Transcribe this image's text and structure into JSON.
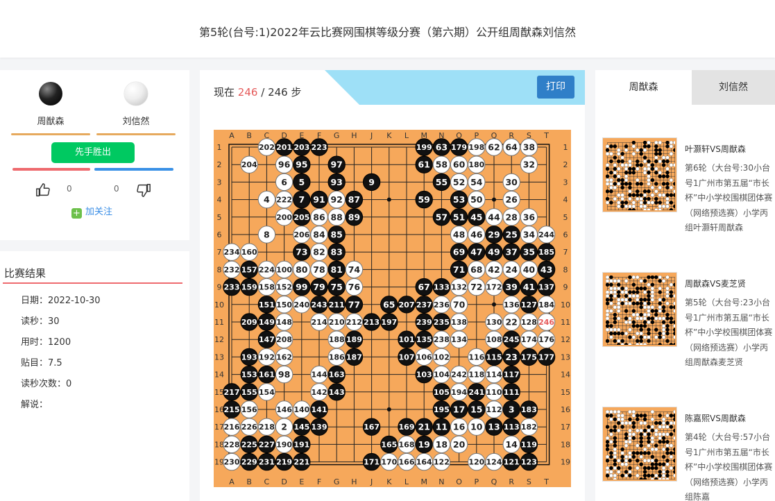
{
  "header": {
    "title": "第5轮(台号:1)2022年云比赛网围棋等级分赛（第六期）公开组周猷森刘信然"
  },
  "players": {
    "black_name": "周猷森",
    "white_name": "刘信然",
    "result_button": "先手胜出",
    "like_count": "0",
    "dislike_count": "0",
    "follow_label": "加关注"
  },
  "result": {
    "title": "比赛结果",
    "items": [
      "日期：2022-10-30",
      "读秒：30",
      "用时：1200",
      "贴目：7.5",
      "读秒次数：0",
      "解说："
    ]
  },
  "board": {
    "move_prefix": "现在",
    "current_move": "246",
    "separator": "/",
    "total_moves": "246",
    "move_suffix": "步",
    "print_label": "打印",
    "columns": [
      "A",
      "B",
      "C",
      "D",
      "E",
      "F",
      "G",
      "H",
      "J",
      "K",
      "L",
      "M",
      "N",
      "O",
      "P",
      "Q",
      "R",
      "S",
      "T"
    ],
    "rows": [
      "1",
      "2",
      "3",
      "4",
      "5",
      "6",
      "7",
      "8",
      "9",
      "10",
      "11",
      "12",
      "13",
      "14",
      "15",
      "16",
      "17",
      "18",
      "19"
    ],
    "last_move_color": "#e55a5a",
    "stones": [
      [
        "C1",
        "w",
        "202"
      ],
      [
        "D1",
        "b",
        "201"
      ],
      [
        "E1",
        "b",
        "203"
      ],
      [
        "F1",
        "b",
        "223"
      ],
      [
        "M1",
        "b",
        "199"
      ],
      [
        "N1",
        "b",
        "63"
      ],
      [
        "O1",
        "b",
        "179"
      ],
      [
        "P1",
        "w",
        "198"
      ],
      [
        "Q1",
        "w",
        "62"
      ],
      [
        "R1",
        "w",
        "64"
      ],
      [
        "S1",
        "w",
        "38"
      ],
      [
        "B2",
        "w",
        "204"
      ],
      [
        "D2",
        "w",
        "96"
      ],
      [
        "E2",
        "b",
        "95"
      ],
      [
        "G2",
        "b",
        "97"
      ],
      [
        "M2",
        "b",
        "61"
      ],
      [
        "N2",
        "w",
        "58"
      ],
      [
        "O2",
        "w",
        "60"
      ],
      [
        "P2",
        "w",
        "180"
      ],
      [
        "S2",
        "w",
        "32"
      ],
      [
        "D3",
        "w",
        "6"
      ],
      [
        "E3",
        "b",
        "5"
      ],
      [
        "G3",
        "b",
        "93"
      ],
      [
        "J3",
        "b",
        "9"
      ],
      [
        "N3",
        "b",
        "55"
      ],
      [
        "O3",
        "w",
        "52"
      ],
      [
        "P3",
        "w",
        "54"
      ],
      [
        "R3",
        "w",
        "30"
      ],
      [
        "C4",
        "w",
        "4"
      ],
      [
        "D4",
        "w",
        "222"
      ],
      [
        "E4",
        "b",
        "7"
      ],
      [
        "F4",
        "b",
        "91"
      ],
      [
        "G4",
        "w",
        "92"
      ],
      [
        "H4",
        "b",
        "87"
      ],
      [
        "M4",
        "b",
        "59"
      ],
      [
        "O4",
        "b",
        "53"
      ],
      [
        "P4",
        "w",
        "50"
      ],
      [
        "R4",
        "w",
        "26"
      ],
      [
        "D5",
        "w",
        "200"
      ],
      [
        "E5",
        "b",
        "205"
      ],
      [
        "F5",
        "w",
        "86"
      ],
      [
        "G5",
        "w",
        "88"
      ],
      [
        "H5",
        "b",
        "89"
      ],
      [
        "N5",
        "b",
        "57"
      ],
      [
        "O5",
        "b",
        "51"
      ],
      [
        "P5",
        "b",
        "45"
      ],
      [
        "Q5",
        "w",
        "44"
      ],
      [
        "R5",
        "w",
        "28"
      ],
      [
        "S5",
        "w",
        "36"
      ],
      [
        "C6",
        "w",
        "8"
      ],
      [
        "E6",
        "w",
        "206"
      ],
      [
        "F6",
        "w",
        "84"
      ],
      [
        "G6",
        "b",
        "85"
      ],
      [
        "O6",
        "w",
        "48"
      ],
      [
        "P6",
        "w",
        "46"
      ],
      [
        "Q6",
        "b",
        "29"
      ],
      [
        "R6",
        "b",
        "25"
      ],
      [
        "S6",
        "w",
        "34"
      ],
      [
        "T6",
        "w",
        "244"
      ],
      [
        "A7",
        "w",
        "234"
      ],
      [
        "B7",
        "w",
        "160"
      ],
      [
        "E7",
        "b",
        "73"
      ],
      [
        "F7",
        "w",
        "82"
      ],
      [
        "G7",
        "b",
        "83"
      ],
      [
        "O7",
        "b",
        "69"
      ],
      [
        "P7",
        "b",
        "47"
      ],
      [
        "Q7",
        "b",
        "49"
      ],
      [
        "R7",
        "b",
        "37"
      ],
      [
        "S7",
        "b",
        "35"
      ],
      [
        "T7",
        "b",
        "185"
      ],
      [
        "A8",
        "w",
        "232"
      ],
      [
        "B8",
        "b",
        "157"
      ],
      [
        "C8",
        "w",
        "224"
      ],
      [
        "D8",
        "w",
        "100"
      ],
      [
        "E8",
        "w",
        "80"
      ],
      [
        "F8",
        "w",
        "78"
      ],
      [
        "G8",
        "b",
        "81"
      ],
      [
        "H8",
        "w",
        "74"
      ],
      [
        "O8",
        "b",
        "71"
      ],
      [
        "P8",
        "w",
        "68"
      ],
      [
        "Q8",
        "w",
        "42"
      ],
      [
        "R8",
        "w",
        "24"
      ],
      [
        "S8",
        "w",
        "40"
      ],
      [
        "T8",
        "b",
        "43"
      ],
      [
        "A9",
        "b",
        "233"
      ],
      [
        "B9",
        "b",
        "159"
      ],
      [
        "C9",
        "w",
        "158"
      ],
      [
        "D9",
        "w",
        "152"
      ],
      [
        "E9",
        "b",
        "99"
      ],
      [
        "F9",
        "b",
        "79"
      ],
      [
        "G9",
        "b",
        "75"
      ],
      [
        "H9",
        "w",
        "76"
      ],
      [
        "M9",
        "b",
        "67"
      ],
      [
        "N9",
        "b",
        "133"
      ],
      [
        "O9",
        "w",
        "132"
      ],
      [
        "P9",
        "w",
        "72"
      ],
      [
        "Q9",
        "w",
        "172"
      ],
      [
        "R9",
        "b",
        "39"
      ],
      [
        "S9",
        "b",
        "41"
      ],
      [
        "T9",
        "b",
        "137"
      ],
      [
        "C10",
        "b",
        "151"
      ],
      [
        "D10",
        "w",
        "150"
      ],
      [
        "E10",
        "w",
        "240"
      ],
      [
        "F10",
        "b",
        "243"
      ],
      [
        "G10",
        "b",
        "211"
      ],
      [
        "H10",
        "b",
        "77"
      ],
      [
        "K10",
        "b",
        "65"
      ],
      [
        "L10",
        "b",
        "207"
      ],
      [
        "M10",
        "b",
        "237"
      ],
      [
        "N10",
        "w",
        "236"
      ],
      [
        "O10",
        "w",
        "70"
      ],
      [
        "R10",
        "w",
        "136"
      ],
      [
        "S10",
        "b",
        "127"
      ],
      [
        "T10",
        "w",
        "184"
      ],
      [
        "B11",
        "b",
        "209"
      ],
      [
        "C11",
        "b",
        "149"
      ],
      [
        "D11",
        "w",
        "148"
      ],
      [
        "F11",
        "w",
        "214"
      ],
      [
        "G11",
        "w",
        "210"
      ],
      [
        "H11",
        "w",
        "212"
      ],
      [
        "J11",
        "b",
        "213"
      ],
      [
        "K11",
        "b",
        "197"
      ],
      [
        "M11",
        "b",
        "239"
      ],
      [
        "N11",
        "b",
        "235"
      ],
      [
        "O11",
        "w",
        "138"
      ],
      [
        "Q11",
        "w",
        "130"
      ],
      [
        "R11",
        "w",
        "22"
      ],
      [
        "S11",
        "w",
        "128"
      ],
      [
        "T11",
        "w",
        "246"
      ],
      [
        "C12",
        "b",
        "147"
      ],
      [
        "D12",
        "w",
        "208"
      ],
      [
        "G12",
        "w",
        "188"
      ],
      [
        "H12",
        "b",
        "189"
      ],
      [
        "L12",
        "b",
        "101"
      ],
      [
        "M12",
        "b",
        "135"
      ],
      [
        "N12",
        "w",
        "238"
      ],
      [
        "O12",
        "w",
        "134"
      ],
      [
        "Q12",
        "w",
        "108"
      ],
      [
        "R12",
        "b",
        "245"
      ],
      [
        "S12",
        "w",
        "174"
      ],
      [
        "T12",
        "w",
        "176"
      ],
      [
        "B13",
        "b",
        "193"
      ],
      [
        "C13",
        "w",
        "192"
      ],
      [
        "D13",
        "w",
        "162"
      ],
      [
        "G13",
        "w",
        "186"
      ],
      [
        "H13",
        "b",
        "187"
      ],
      [
        "L13",
        "b",
        "107"
      ],
      [
        "M13",
        "w",
        "106"
      ],
      [
        "N13",
        "w",
        "102"
      ],
      [
        "P13",
        "w",
        "116"
      ],
      [
        "Q13",
        "b",
        "115"
      ],
      [
        "R13",
        "b",
        "23"
      ],
      [
        "S13",
        "b",
        "175"
      ],
      [
        "T13",
        "b",
        "177"
      ],
      [
        "B14",
        "b",
        "153"
      ],
      [
        "C14",
        "b",
        "161"
      ],
      [
        "D14",
        "w",
        "98"
      ],
      [
        "F14",
        "w",
        "144"
      ],
      [
        "G14",
        "b",
        "163"
      ],
      [
        "M14",
        "b",
        "103"
      ],
      [
        "N14",
        "w",
        "104"
      ],
      [
        "O14",
        "w",
        "242"
      ],
      [
        "P14",
        "w",
        "118"
      ],
      [
        "Q14",
        "w",
        "114"
      ],
      [
        "R14",
        "b",
        "117"
      ],
      [
        "A15",
        "b",
        "217"
      ],
      [
        "B15",
        "b",
        "155"
      ],
      [
        "C15",
        "w",
        "154"
      ],
      [
        "F15",
        "w",
        "142"
      ],
      [
        "G15",
        "b",
        "143"
      ],
      [
        "N15",
        "b",
        "105"
      ],
      [
        "O15",
        "w",
        "194"
      ],
      [
        "P15",
        "b",
        "241"
      ],
      [
        "Q15",
        "w",
        "110"
      ],
      [
        "R15",
        "b",
        "111"
      ],
      [
        "A16",
        "b",
        "215"
      ],
      [
        "B16",
        "w",
        "156"
      ],
      [
        "D16",
        "w",
        "146"
      ],
      [
        "E16",
        "w",
        "140"
      ],
      [
        "F16",
        "b",
        "141"
      ],
      [
        "N16",
        "b",
        "195"
      ],
      [
        "O16",
        "b",
        "17"
      ],
      [
        "P16",
        "b",
        "15"
      ],
      [
        "Q16",
        "w",
        "112"
      ],
      [
        "R16",
        "b",
        "3"
      ],
      [
        "S16",
        "b",
        "183"
      ],
      [
        "A17",
        "w",
        "216"
      ],
      [
        "B17",
        "w",
        "226"
      ],
      [
        "C17",
        "w",
        "218"
      ],
      [
        "D17",
        "w",
        "2"
      ],
      [
        "E17",
        "b",
        "145"
      ],
      [
        "F17",
        "b",
        "139"
      ],
      [
        "J17",
        "b",
        "167"
      ],
      [
        "L17",
        "b",
        "169"
      ],
      [
        "M17",
        "b",
        "21"
      ],
      [
        "N17",
        "b",
        "11"
      ],
      [
        "O17",
        "w",
        "16"
      ],
      [
        "P17",
        "w",
        "10"
      ],
      [
        "Q17",
        "b",
        "13"
      ],
      [
        "R17",
        "b",
        "113"
      ],
      [
        "S17",
        "w",
        "182"
      ],
      [
        "A18",
        "w",
        "228"
      ],
      [
        "B18",
        "b",
        "225"
      ],
      [
        "C18",
        "b",
        "227"
      ],
      [
        "D18",
        "w",
        "190"
      ],
      [
        "E18",
        "b",
        "191"
      ],
      [
        "K18",
        "b",
        "165"
      ],
      [
        "L18",
        "w",
        "168"
      ],
      [
        "M18",
        "b",
        "19"
      ],
      [
        "N18",
        "w",
        "18"
      ],
      [
        "O18",
        "w",
        "20"
      ],
      [
        "R18",
        "w",
        "14"
      ],
      [
        "S18",
        "b",
        "119"
      ],
      [
        "A19",
        "w",
        "230"
      ],
      [
        "B19",
        "b",
        "229"
      ],
      [
        "C19",
        "b",
        "231"
      ],
      [
        "D19",
        "b",
        "219"
      ],
      [
        "E19",
        "b",
        "221"
      ],
      [
        "J19",
        "b",
        "171"
      ],
      [
        "K19",
        "w",
        "170"
      ],
      [
        "L19",
        "w",
        "166"
      ],
      [
        "M19",
        "w",
        "164"
      ],
      [
        "N19",
        "w",
        "122"
      ],
      [
        "P19",
        "w",
        "120"
      ],
      [
        "Q19",
        "w",
        "124"
      ],
      [
        "R19",
        "b",
        "121"
      ],
      [
        "S19",
        "b",
        "123"
      ]
    ]
  },
  "right": {
    "tab_active": "周猷森",
    "tab_inactive": "刘信然",
    "games": [
      {
        "title": "叶灏轩VS周猷森",
        "desc": "第6轮（大台号:30小台号1广州市第五届“市长杯”中小学校围棋团体赛（网络预选赛）小学丙组叶灏轩周猷森"
      },
      {
        "title": "周猷森VS麦芝贤",
        "desc": "第5轮（大台号:23小台号1广州市第五届“市长杯”中小学校围棋团体赛（网络预选赛）小学丙组周猷森麦芝贤"
      },
      {
        "title": "陈嘉熙VS周猷森",
        "desc": "第4轮（大台号:57小台号1广州市第五届“市长杯”中小学校围棋团体赛（网络预选赛）小学丙组陈嘉"
      }
    ]
  }
}
